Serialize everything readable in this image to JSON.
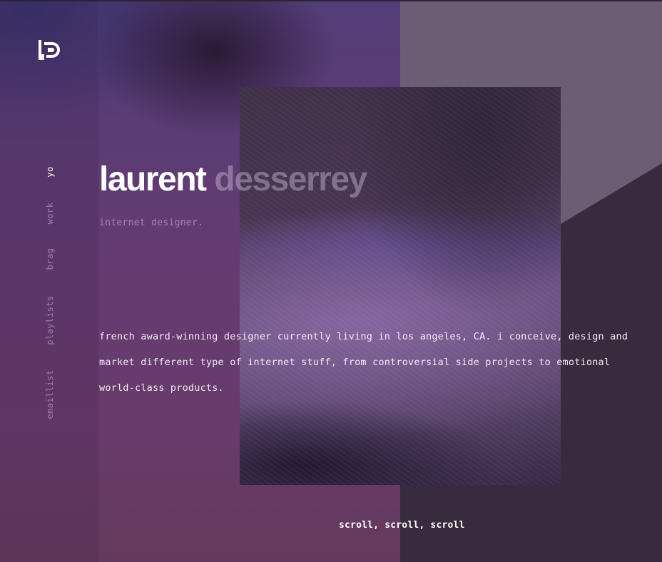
{
  "logo": {
    "icon": "ld-monogram-icon"
  },
  "nav": {
    "items": [
      {
        "label": "yo",
        "active": true
      },
      {
        "label": "work",
        "active": false
      },
      {
        "label": "brag",
        "active": false
      },
      {
        "label": "playlists",
        "active": false
      },
      {
        "label": "emaillist",
        "active": false
      }
    ]
  },
  "hero": {
    "first_name": "laurent",
    "last_name": "desserrey",
    "role": "internet designer.",
    "bio": "french award-winning designer currently living in los angeles, CA. i conceive, design and market different type of internet stuff, from controversial side projects to emotional world-class products."
  },
  "footer": {
    "scroll_hint": "scroll, scroll, scroll"
  },
  "colors": {
    "left_panel": "#643b71",
    "right_panel": "#382b3e",
    "right_panel_light": "#6b5e74",
    "text": "#ffffff",
    "muted_text": "#c8b4d2"
  }
}
